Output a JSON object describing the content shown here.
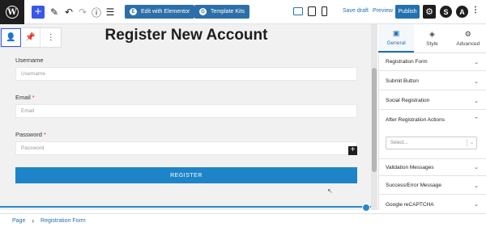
{
  "topbar": {
    "wp_logo": "W",
    "add_icon": "+",
    "edit_elementor_label": "Edit with Elementor",
    "template_kits_label": "Template Kits",
    "save_draft_label": "Save draft",
    "preview_label": "Preview",
    "publish_label": "Publish"
  },
  "form": {
    "title": "Register New Account",
    "username_label": "Username",
    "username_placeholder": "Username",
    "email_label": "Email",
    "email_placeholder": "Email",
    "password_label": "Password",
    "password_placeholder": "Password",
    "required_mark": "*",
    "register_label": "REGISTER"
  },
  "sidebar": {
    "tabs": [
      {
        "label": "General",
        "icon": "general-icon",
        "active": true
      },
      {
        "label": "Style",
        "icon": "style-icon",
        "active": false
      },
      {
        "label": "Advanced",
        "icon": "gear-icon",
        "active": false
      }
    ],
    "sections": [
      "Registration Form",
      "Submit Button",
      "Social Registration",
      "After Registration Actions",
      "Validation Messages",
      "Success/Error Message",
      "Google reCAPTCHA"
    ],
    "select_placeholder": "Select..."
  },
  "breadcrumb": {
    "root": "Page",
    "current": "Registration Form"
  },
  "colors": {
    "accent": "#2271b1",
    "wp_blue": "#3858e9",
    "elementor_blue": "#2c6fa8",
    "register_button": "#1e84c8",
    "required": "#d63638"
  }
}
